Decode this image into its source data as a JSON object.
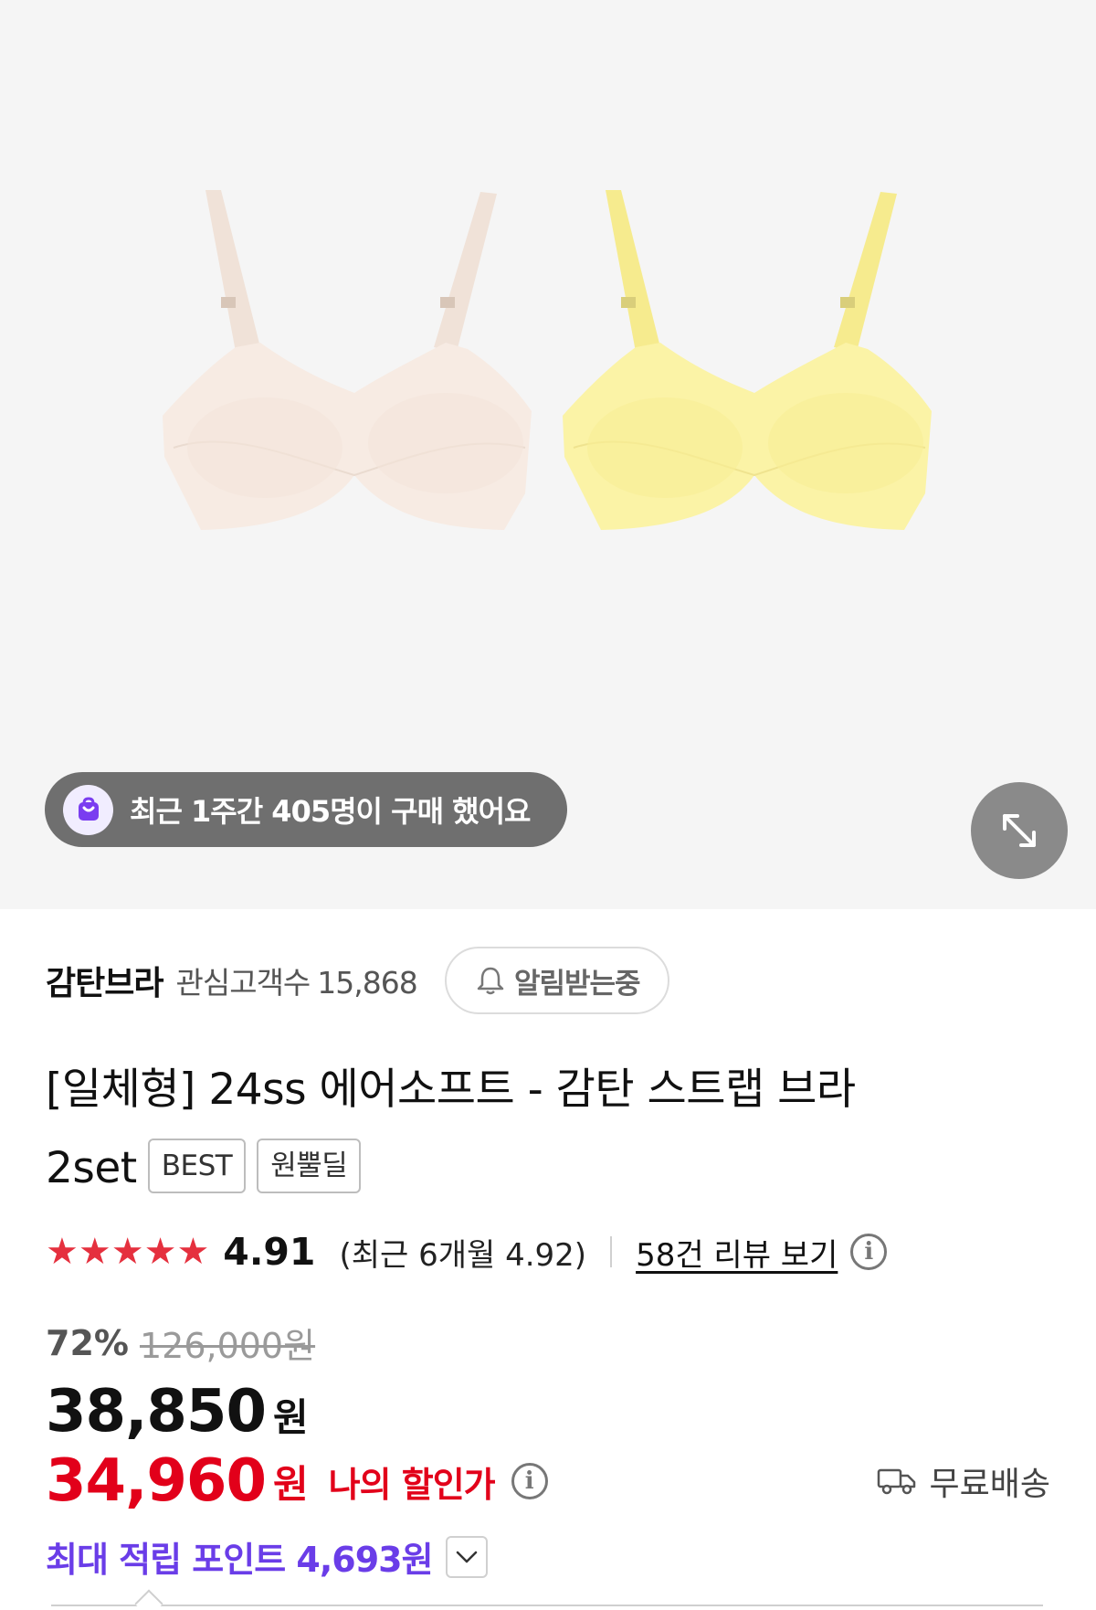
{
  "hero": {
    "purchase_notice": "최근 1주간 405명이 구매 했어요",
    "icons": [
      "shopping-bag-icon",
      "expand-icon"
    ]
  },
  "brand": {
    "name": "감탄브라",
    "fans_label": "관심고객수",
    "fans_count": "15,868",
    "alarm_label": "알림받는중"
  },
  "product": {
    "title_line1": "[일체형] 24ss 에어소프트 - 감탄 스트랩 브라",
    "title_line2": "2set",
    "badges": [
      "BEST",
      "원뿔딜"
    ]
  },
  "rating": {
    "stars": "★★★★★",
    "score": "4.91",
    "recent": "(최근 6개월 4.92)",
    "review_link": "58건 리뷰 보기",
    "info_glyph": "i"
  },
  "price": {
    "discount_pct": "72%",
    "original": "126,000원",
    "sale": "38,850",
    "currency": "원",
    "my_price": "34,960",
    "my_currency": "원",
    "my_label": "나의 할인가",
    "shipping": "무료배송",
    "points": "최대 적립 포인트 4,693원"
  },
  "colors": {
    "accent_red": "#e2001a",
    "star_red": "#e5303e",
    "points_purple": "#6a3de8",
    "pill_gray": "#6f6f6f"
  }
}
